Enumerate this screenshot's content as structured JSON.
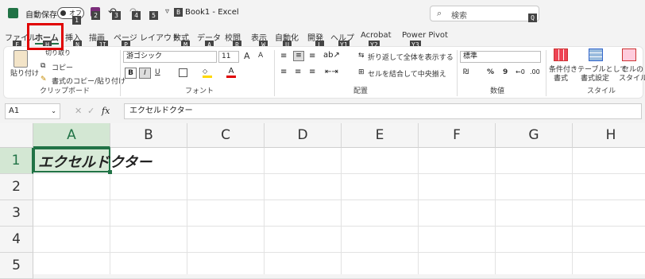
{
  "titlebar": {
    "autosave_label": "自動保存",
    "toggle_state": "オフ",
    "title": "Book1 - Excel",
    "qat_keys": [
      "1",
      "2",
      "3",
      "4",
      "5"
    ],
    "title_key": "B"
  },
  "search": {
    "placeholder": "検索",
    "key": "Q"
  },
  "tabs": [
    {
      "label": "ファイル",
      "key": "F"
    },
    {
      "label": "ホーム",
      "key": "H"
    },
    {
      "label": "挿入",
      "key": "N"
    },
    {
      "label": "描画",
      "key": "JI"
    },
    {
      "label": "ページ レイアウト",
      "key": "P"
    },
    {
      "label": "数式",
      "key": "M"
    },
    {
      "label": "データ",
      "key": "A"
    },
    {
      "label": "校閲",
      "key": "R"
    },
    {
      "label": "表示",
      "key": "W"
    },
    {
      "label": "自動化",
      "key": "U"
    },
    {
      "label": "開発",
      "key": "L"
    },
    {
      "label": "ヘルプ",
      "key": "Y1"
    },
    {
      "label": "Acrobat",
      "key": "Y2"
    },
    {
      "label": "Power Pivot",
      "key": "Y3"
    }
  ],
  "ribbon": {
    "clipboard": {
      "paste": "貼り付け",
      "cut": "切り取り",
      "copy": "コピー",
      "format_copy": "書式のコピー/貼り付け",
      "group": "クリップボード"
    },
    "font": {
      "font_name": "游ゴシック",
      "font_size": "11",
      "grow": "A",
      "shrink": "A",
      "bold": "B",
      "italic": "I",
      "underline": "U",
      "font_color": "A",
      "group": "フォント"
    },
    "alignment": {
      "wrap": "折り返して全体を表示する",
      "merge": "セルを結合して中央揃え",
      "group": "配置"
    },
    "number": {
      "format": "標準",
      "percent": "%",
      "comma": "9",
      "group": "数値"
    },
    "styles": {
      "conditional": "条件付き",
      "conditional2": "書式",
      "table": "テーブルとして",
      "table2": "書式設定",
      "cell": "セルの",
      "cell2": "スタイル",
      "group": "スタイル"
    }
  },
  "formula_bar": {
    "name_box": "A1",
    "fx": "fx",
    "content": "エクセルドクター"
  },
  "sheet": {
    "columns": [
      "A",
      "B",
      "C",
      "D",
      "E",
      "F",
      "G",
      "H"
    ],
    "rows": [
      "1",
      "2",
      "3",
      "4",
      "5"
    ],
    "a1": "エクセルドクター"
  },
  "colors": {
    "excel_green": "#217346",
    "highlight_red": "#e00000"
  }
}
